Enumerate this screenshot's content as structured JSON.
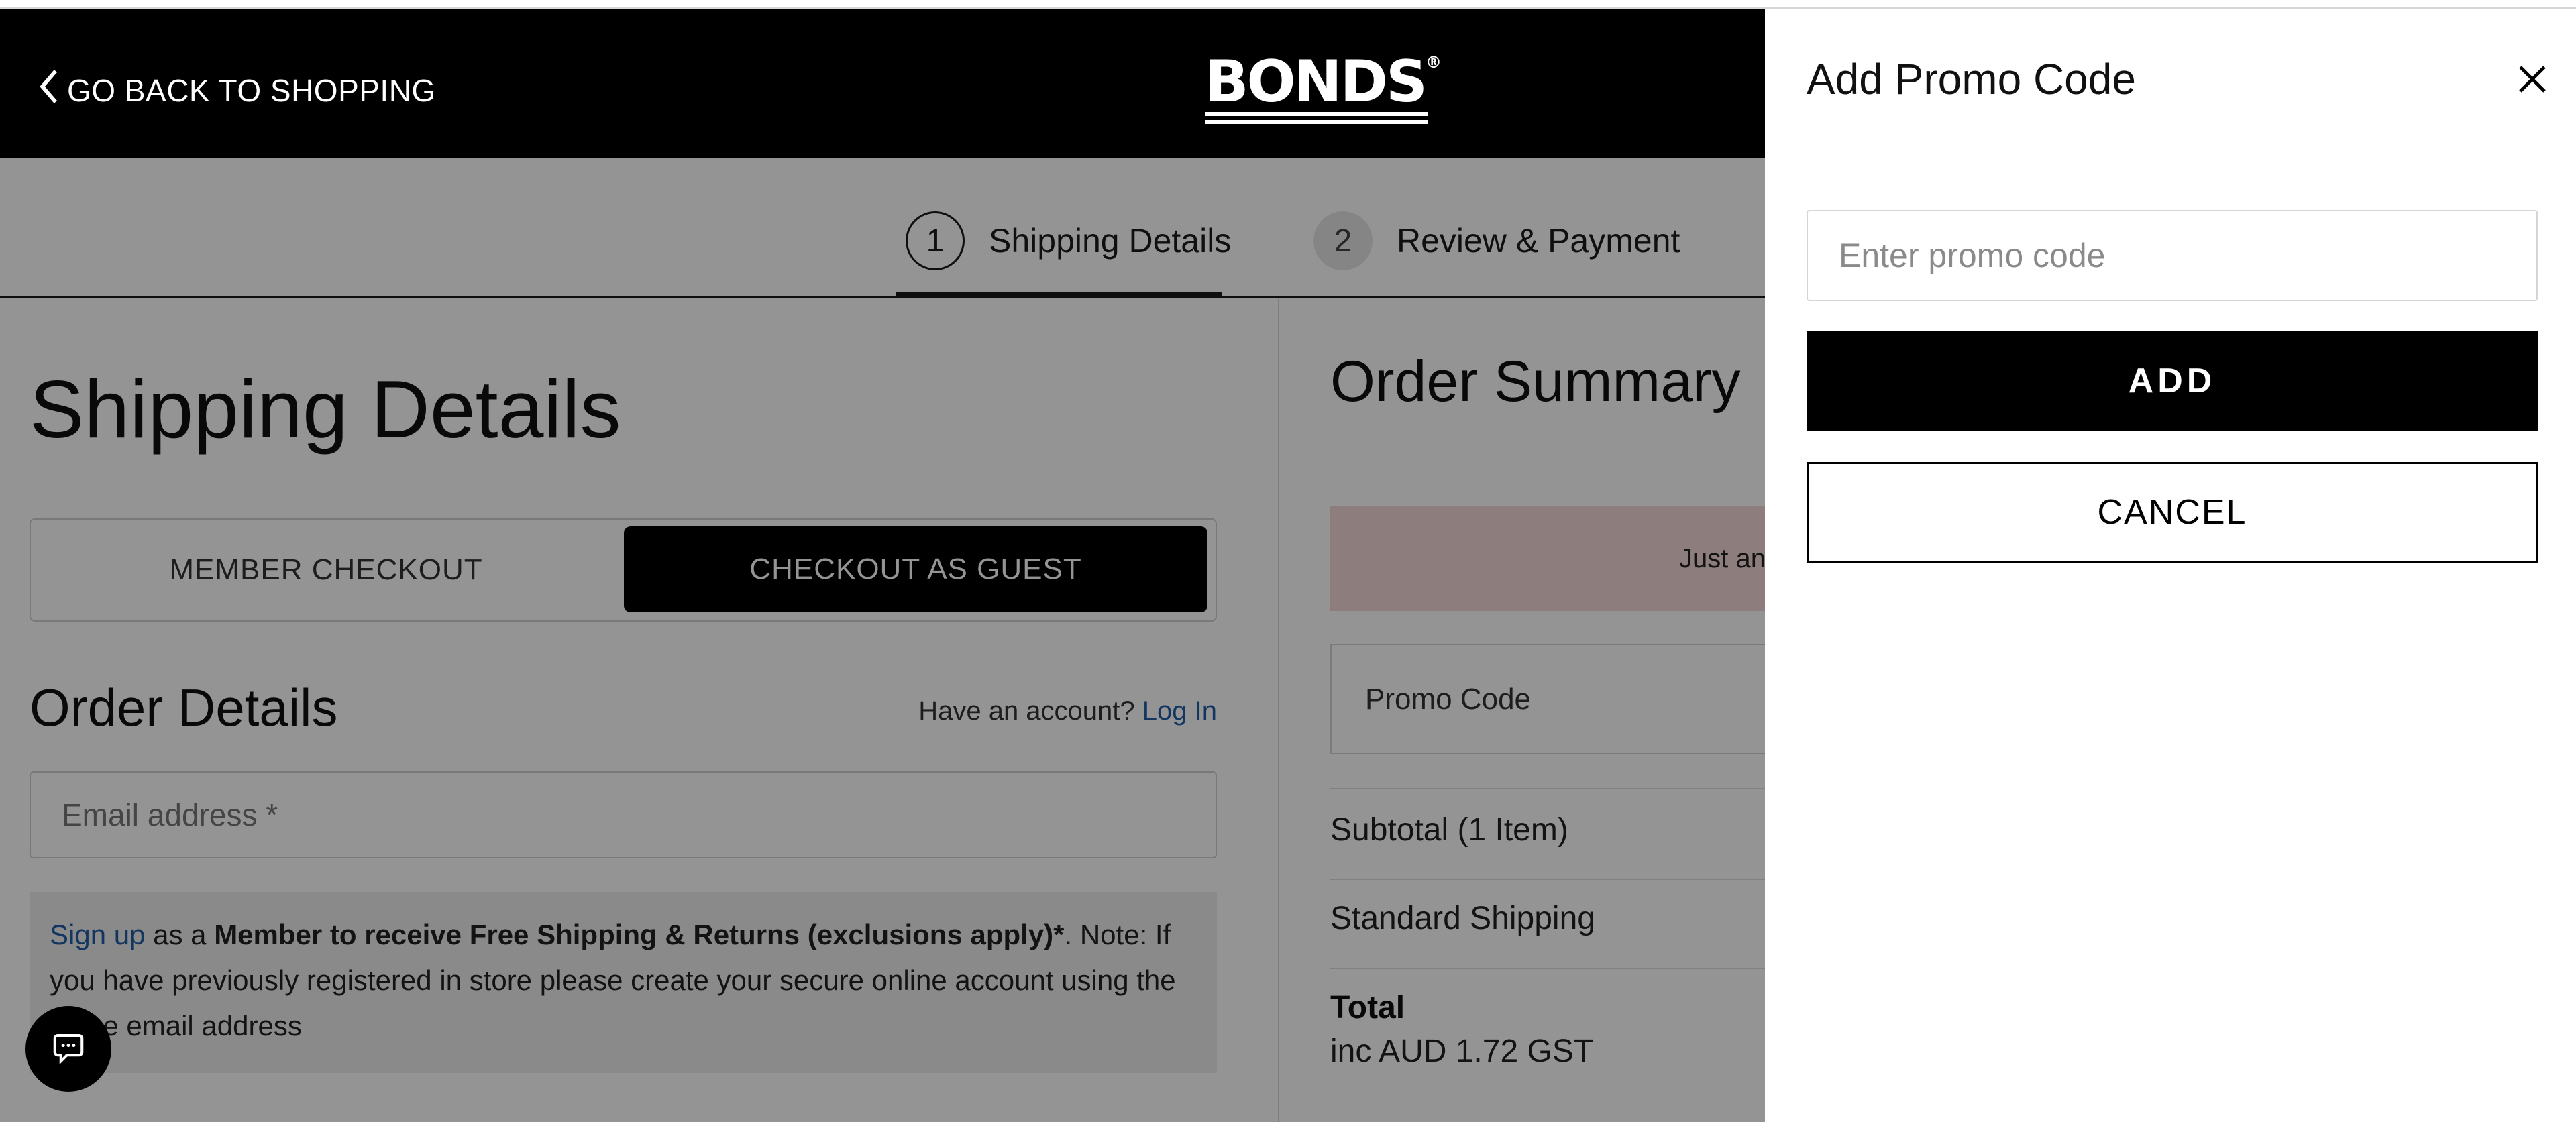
{
  "header": {
    "back_label": "GO BACK TO SHOPPING",
    "logo_text": "BONDS",
    "logo_mark": "®"
  },
  "stepper": {
    "steps": [
      {
        "number": "1",
        "label": "Shipping Details",
        "active": true
      },
      {
        "number": "2",
        "label": "Review & Payment",
        "active": false
      }
    ]
  },
  "shipping": {
    "title": "Shipping Details",
    "member_checkout": "MEMBER CHECKOUT",
    "guest_checkout": "CHECKOUT AS GUEST",
    "order_details_title": "Order Details",
    "have_account": "Have an account?",
    "log_in": "Log In",
    "email_placeholder": "Email address *",
    "note": {
      "sign_up": "Sign up",
      "as_a": " as a ",
      "bold": "Member to receive Free Shipping & Returns (exclusions apply)*",
      "rest": ". Note: If you have previously registered in store please create your secure online account using the same email address"
    }
  },
  "summary": {
    "title": "Order Summary",
    "banner_text": "Just an",
    "promo_code_label": "Promo Code",
    "subtotal_label": "Subtotal (1 Item)",
    "shipping_label": "Standard Shipping",
    "total_label": "Total",
    "gst_label": "inc AUD 1.72 GST"
  },
  "drawer": {
    "title": "Add Promo Code",
    "input_placeholder": "Enter promo code",
    "input_value": "",
    "add_label": "ADD",
    "cancel_label": "CANCEL"
  },
  "icons": {
    "back": "chevron-left-icon",
    "close": "close-icon",
    "chat": "chat-icon"
  },
  "colors": {
    "link": "#1f5da6",
    "header_bg": "#000000",
    "banner_bg": "#f3d8d6",
    "overlay": "rgba(0,0,0,0.42)"
  }
}
